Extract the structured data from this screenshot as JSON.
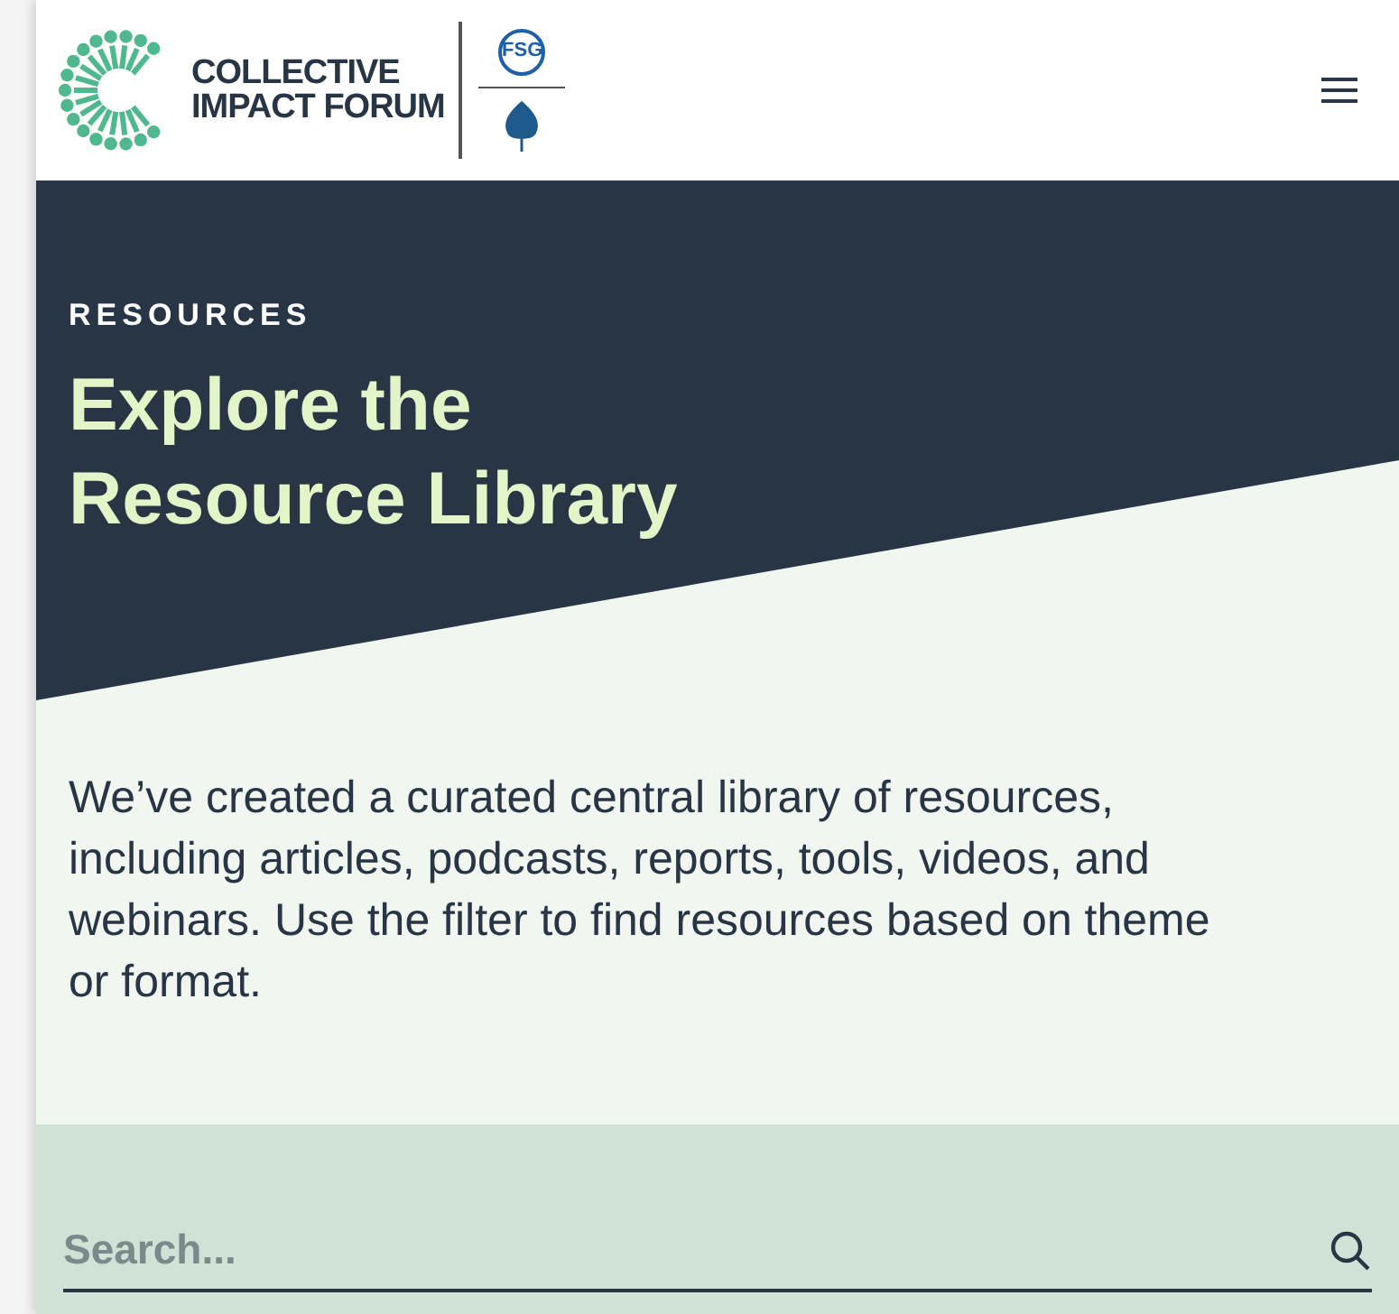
{
  "header": {
    "logo": {
      "line_1": "COLLECTIVE",
      "line_2": "IMPACT FORUM",
      "partner": "FSG"
    }
  },
  "hero": {
    "eyebrow": "RESOURCES",
    "title_line_1": "Explore the",
    "title_line_2": "Resource Library"
  },
  "intro": "We’ve created a curated central library of resources, including articles, podcasts, reports, tools, videos, and webinars. Use the filter to find resources based on theme or format.",
  "search": {
    "placeholder": "Search..."
  }
}
